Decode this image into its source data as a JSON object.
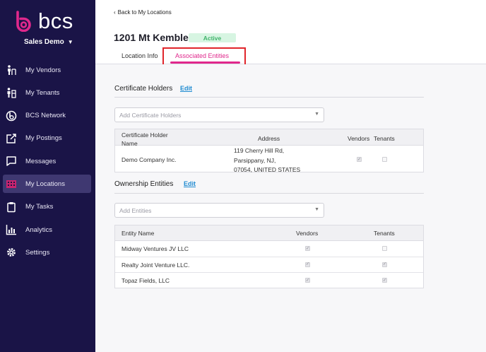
{
  "brand": {
    "logo_text": "bcs",
    "account_name": "Sales Demo"
  },
  "sidebar": {
    "items": [
      {
        "label": "My Vendors",
        "icon": "vendors-icon"
      },
      {
        "label": "My Tenants",
        "icon": "tenants-icon"
      },
      {
        "label": "BCS Network",
        "icon": "network-icon"
      },
      {
        "label": "My Postings",
        "icon": "postings-icon"
      },
      {
        "label": "Messages",
        "icon": "messages-icon"
      },
      {
        "label": "My Locations",
        "icon": "locations-icon",
        "active": true
      },
      {
        "label": "My Tasks",
        "icon": "tasks-icon"
      },
      {
        "label": "Analytics",
        "icon": "analytics-icon"
      },
      {
        "label": "Settings",
        "icon": "settings-icon"
      }
    ]
  },
  "header": {
    "back_link": "Back to My Locations",
    "title": "1201 Mt Kemble",
    "status": "Active",
    "tabs": [
      {
        "label": "Location Info"
      },
      {
        "label": "Associated Entities",
        "active": true
      }
    ]
  },
  "certificate_holders": {
    "title": "Certificate Holders",
    "edit_label": "Edit",
    "placeholder": "Add Certificate Holders",
    "columns": [
      "Certificate Holder Name",
      "Address",
      "Vendors",
      "Tenants"
    ],
    "rows": [
      {
        "name": "Demo Company Inc.",
        "address_lines": [
          "119 Cherry Hill Rd,",
          "Parsippany, NJ,",
          "07054, UNITED STATES"
        ],
        "vendors": true,
        "tenants": false
      }
    ]
  },
  "ownership_entities": {
    "title": "Ownership Entities",
    "edit_label": "Edit",
    "placeholder": "Add Entities",
    "columns": [
      "Entity Name",
      "Vendors",
      "Tenants"
    ],
    "rows": [
      {
        "name": "Midway Ventures JV LLC",
        "vendors": true,
        "tenants": false
      },
      {
        "name": "Realty Joint Venture LLC.",
        "vendors": true,
        "tenants": true
      },
      {
        "name": "Topaz Fields, LLC",
        "vendors": true,
        "tenants": true
      }
    ]
  },
  "colors": {
    "sidebar_bg": "#1a1447",
    "accent_pink": "#e0288c",
    "active_green_bg": "#d7f5e2",
    "active_green_text": "#3fb36a",
    "link_blue": "#1f8bd1",
    "annotation_red": "#e0252b"
  }
}
